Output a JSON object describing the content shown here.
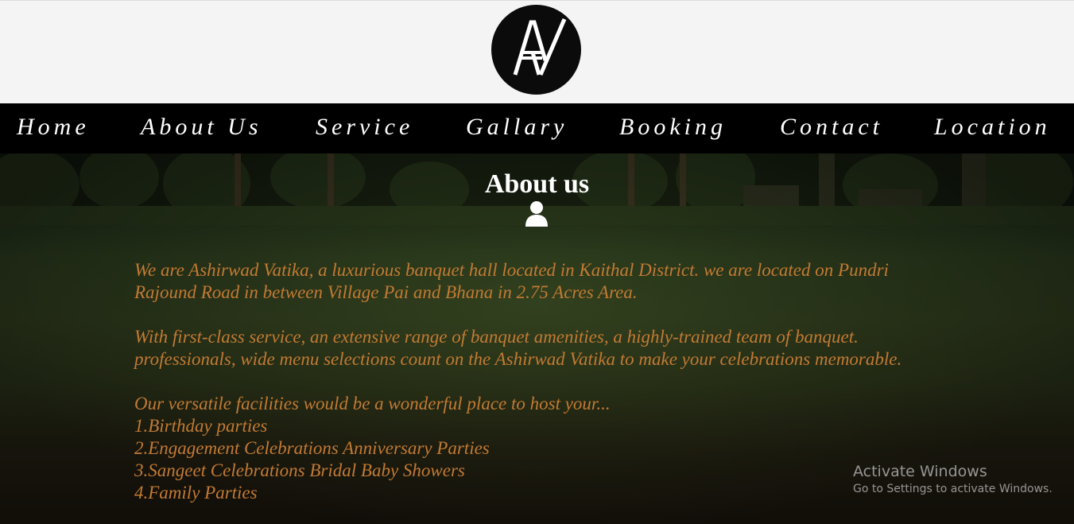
{
  "brand": {
    "logo_text": "AV"
  },
  "nav": {
    "items": [
      {
        "label": "Home"
      },
      {
        "label": "About Us"
      },
      {
        "label": "Service"
      },
      {
        "label": "Gallary"
      },
      {
        "label": "Booking"
      },
      {
        "label": "Contact"
      },
      {
        "label": "Location"
      }
    ]
  },
  "about": {
    "title": "About us",
    "icon": "user-icon",
    "paragraph_1": "We are Ashirwad Vatika, a luxurious banquet hall located in Kaithal District. we are located on Pundri Rajound Road in between Village Pai and Bhana in 2.75 Acres Area.",
    "paragraph_2": "With first-class service, an extensive range of banquet amenities, a highly-trained team of banquet. professionals, wide menu selections count on the Ashirwad Vatika to make your celebrations memorable.",
    "intro": "Our versatile facilities would be a wonderful place to host your...",
    "services": [
      "1.Birthday parties",
      "2.Engagement Celebrations Anniversary Parties",
      "3.Sangeet Celebrations Bridal Baby Showers",
      "4.Family Parties"
    ]
  },
  "watermark": {
    "title": "Activate Windows",
    "subtitle": "Go to Settings to activate Windows."
  },
  "colors": {
    "header_bg": "#f4f4f4",
    "nav_bg": "#000000",
    "nav_text": "#ffffff",
    "body_text": "#c27a33",
    "title_text": "#ffffff"
  }
}
